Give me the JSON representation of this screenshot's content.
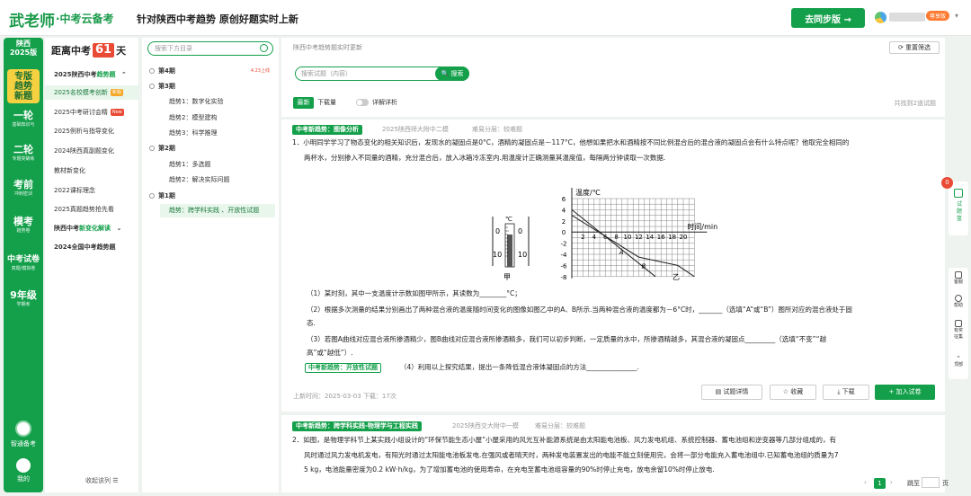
{
  "header": {
    "logo_main": "武老师",
    "logo_sub": "·中考云备考",
    "slogan": "针对陕西中考趋势 原创好题实时上新",
    "sync_button": "去同步版 →",
    "vip_badge": "尊享版",
    "user_caret": "▾"
  },
  "leftnav": {
    "province": "陕西\n2025版",
    "items": [
      {
        "label": "专版\n趋势\n新题",
        "sub": "",
        "active": true
      },
      {
        "label": "一轮",
        "sub": "基础知识与"
      },
      {
        "label": "二轮",
        "sub": "专题突破练"
      },
      {
        "label": "考前",
        "sub": "冲刺密训"
      },
      {
        "label": "模考",
        "sub": "趋势卷"
      },
      {
        "label": "中考试卷",
        "sub": "真题/模拟卷"
      },
      {
        "label": "9年级",
        "sub": "学期考"
      }
    ],
    "ai_label": "智通备考",
    "me_label": "我的"
  },
  "col2": {
    "countdown_prefix": "距离中考",
    "countdown_days": "61",
    "countdown_suffix": "天",
    "items": [
      {
        "text": "2025陕西中考",
        "hl": "趋势题",
        "caret": "⌃",
        "group": true
      },
      {
        "text": "2025名校模考创新",
        "tag": "新题",
        "tag_color": "#f5a623",
        "active": true
      },
      {
        "text": "2025中考研讨会精",
        "tag": "New",
        "tag_color": "#e94a35"
      },
      {
        "text": "2025例析与指导变化"
      },
      {
        "text": "2024陕西真副题变化"
      },
      {
        "text": "教材新变化"
      },
      {
        "text": "2022课标理念"
      },
      {
        "text": "2025真题趋势抢先看"
      },
      {
        "text": "陕西中考",
        "hl": "新变化解读",
        "caret": "⌄",
        "group": true
      },
      {
        "text": "2024全国中考趋势题",
        "group": true
      }
    ],
    "collapse": "收起该列 ☰"
  },
  "directory": {
    "search_placeholder": "搜索下方目录",
    "items": [
      {
        "text": "第4期",
        "date": "4.23上线",
        "type": "period"
      },
      {
        "text": "第3期",
        "type": "period"
      },
      {
        "text": "趋势1：数字化实验",
        "type": "sub"
      },
      {
        "text": "趋势2：模型建构",
        "type": "sub"
      },
      {
        "text": "趋势3：科学推理",
        "type": "sub"
      },
      {
        "text": "第2期",
        "type": "period"
      },
      {
        "text": "趋势1：多选题",
        "type": "sub"
      },
      {
        "text": "趋势2：解决实际问题",
        "type": "sub"
      },
      {
        "text": "第1期",
        "type": "period"
      },
      {
        "text": "趋势：跨学科实践 、开放性试题",
        "type": "sub",
        "active": true
      }
    ]
  },
  "main": {
    "breadcrumb": "陕西中考趋势题实时更新",
    "reset": "⟳ 重置筛选",
    "search_placeholder": "搜索试题（内容）",
    "search_button": "🔍 搜索",
    "tab_new": "最新",
    "tab_downloads": "下载量",
    "toggle_label": "详解详析",
    "total": "共找到2道试题",
    "q1": {
      "tag": "中考新趋势：图像分析",
      "source": "2025陕西师大附中二模",
      "difficulty": "难易分层：较难题",
      "line1": "1．小明同学学习了物态变化的相关知识后，发现水的凝固点是0°C，酒精的凝固点是－117°C，他想如果把水和酒精按不同比例混合后的混合液的凝固点会有什么特点呢？他取完全相同的",
      "line2": "两杯水，分别掺入不同量的酒精，充分混合后，放入冰箱冷冻室内.用温度计正确测量其温度值，每隔两分钟读取一次数据.",
      "fig_left_label": "甲",
      "fig_right_label": "乙",
      "fig_unit": "℃",
      "ylabel": "温度/℃",
      "xlabel": "时间/min",
      "yticks": [
        "6",
        "4",
        "2",
        "0",
        "-2",
        "-4",
        "-6",
        "-8"
      ],
      "xticks": [
        "2",
        "4",
        "6",
        "8",
        "10",
        "12",
        "14",
        "16",
        "18",
        "20"
      ],
      "curve_a": "A",
      "curve_b": "B",
      "thermo_labels": [
        "0",
        "10",
        "0",
        "10"
      ],
      "sub1": "（1）某时刻，其中一支温度计示数如图甲所示，其读数为________°C；",
      "sub2a": "（2）根据多次测量的结果分别画出了两种混合液的温度随时间变化的图像如图乙中的A、B所示.当两种混合液的温度都为－6°C时，_______（选填“A”或“B”）图所对应的混合液处于固",
      "sub2b": "态.",
      "sub3a": "（3）若图A曲线对应混合液所掺酒精少，图B曲线对应混合液所掺酒精多，我们可以初步判断，一定质量的水中，所掺酒精越多，其混合液的凝固点_________（选填“不变”“越",
      "sub3b": "高”或“越低”）.",
      "tag_open": "中考新趋势：开放性试题",
      "sub4": "（4）利用以上探究结果，提出一条降低混合液体凝固点的方法_______________.",
      "footer": "上新时间：2025-03-03  下载：17次",
      "btn_detail": "试题详情",
      "btn_fav": "☆ 收藏",
      "btn_download": "下载",
      "btn_add": "+ 加入试卷"
    },
    "q2": {
      "tag": "中考新趋势：跨学科实践-物理学与工程实践",
      "source": "2025陕西交大附中一模",
      "difficulty": "难易分层：较难题",
      "line1": "2．如图，是物理学科节上某实践小组设计的“环保节能生态小屋”小屋采用的风光互补能源系统是由太阳能电池板、风力发电机组、系统控制器、蓄电池组和逆变器等几部分组成的，有",
      "line2": "风时通过风力发电机发电，有阳光时通过太阳能电池板发电.在强风或者晴天时，两种发电装置发出的电能不能立刻使用完，会将一部分电能充入蓄电池组中.已知蓄电池组的质量为7",
      "line3": "5 kg，电池能量密度为0.2 kW·h/kg，为了增加蓄电池的使用寿命，在充电至蓄电池组容量的90%时停止充电，放电余留10%时停止放电."
    },
    "pager": {
      "prev": "‹",
      "current": "1",
      "next": "›",
      "goto": "跳至",
      "unit": "页"
    }
  },
  "rightbar": {
    "cart_count": "0",
    "cart_label": "试题篮",
    "tools": [
      "客服",
      "帮助",
      "有奖征集",
      "顶部"
    ]
  },
  "colors": {
    "primary": "#14a04b",
    "accent": "#e94a35",
    "highlight": "#f5d142"
  }
}
